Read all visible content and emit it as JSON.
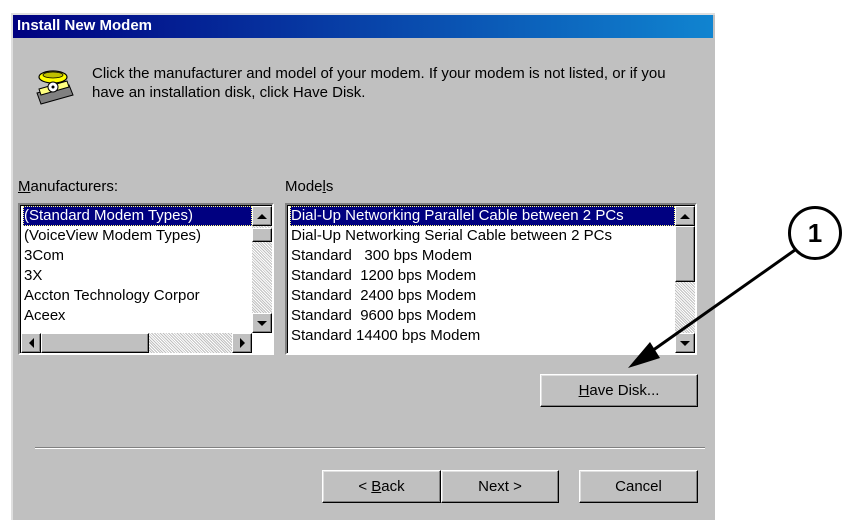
{
  "dialog": {
    "title": "Install New Modem",
    "instruction": "Click the manufacturer and model of your modem. If your modem is not listed, or if you have an installation disk, click Have Disk."
  },
  "manufacturers": {
    "label_prefix": "",
    "label_underlined": "M",
    "label_suffix": "anufacturers:",
    "items": [
      "(Standard Modem Types)",
      "(VoiceView Modem Types)",
      "3Com",
      "3X",
      "Accton Technology Corpor",
      "Acеех"
    ],
    "selected_index": 0
  },
  "models": {
    "label_prefix": "Mode",
    "label_underlined": "l",
    "label_suffix": "s",
    "items": [
      "Dial-Up Networking Parallel Cable between 2 PCs",
      "Dial-Up Networking Serial Cable between 2 PCs",
      "Standard   300 bps Modem",
      "Standard  1200 bps Modem",
      "Standard  2400 bps Modem",
      "Standard  9600 bps Modem",
      "Standard 14400 bps Modem"
    ],
    "selected_index": 0
  },
  "buttons": {
    "have_disk_underlined": "H",
    "have_disk_rest": "ave Disk...",
    "back_prefix": "< ",
    "back_underlined": "B",
    "back_rest": "ack",
    "next": "Next >",
    "cancel": "Cancel"
  },
  "callout": {
    "number": "1"
  },
  "colors": {
    "titlebar": "#000080",
    "selection": "#000080",
    "face": "#c0c0c0"
  }
}
